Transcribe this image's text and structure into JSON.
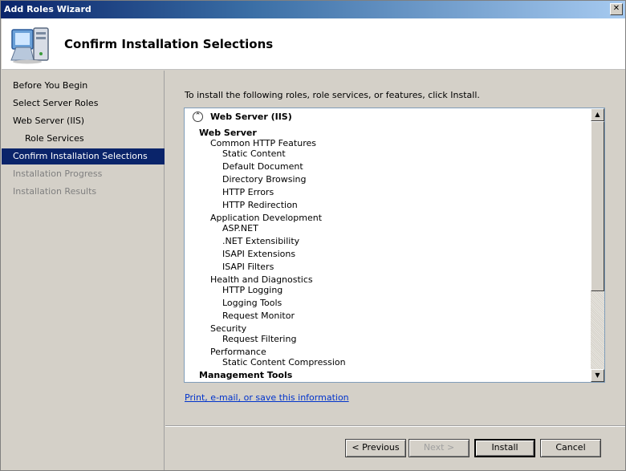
{
  "window": {
    "title": "Add Roles Wizard",
    "close_glyph": "✕"
  },
  "header": {
    "title": "Confirm Installation Selections",
    "icon": "computer-roles-icon"
  },
  "nav": {
    "items": [
      {
        "label": "Before You Begin",
        "state": "normal"
      },
      {
        "label": "Select Server Roles",
        "state": "normal"
      },
      {
        "label": "Web Server (IIS)",
        "state": "normal"
      },
      {
        "label": "Role Services",
        "state": "normal"
      },
      {
        "label": "Confirm Installation Selections",
        "state": "active"
      },
      {
        "label": "Installation Progress",
        "state": "disabled"
      },
      {
        "label": "Installation Results",
        "state": "disabled"
      }
    ]
  },
  "content": {
    "instruction": "To install the following roles, role services, or features, click Install.",
    "role_header": "Web Server (IIS)",
    "collapse_glyph": "⌃",
    "lines": [
      {
        "text": "Web Server",
        "level": 0
      },
      {
        "text": "Common HTTP Features",
        "level": 1
      },
      {
        "text": "Static Content",
        "level": 2
      },
      {
        "text": "Default Document",
        "level": 2
      },
      {
        "text": "Directory Browsing",
        "level": 2
      },
      {
        "text": "HTTP Errors",
        "level": 2
      },
      {
        "text": "HTTP Redirection",
        "level": 2
      },
      {
        "text": "Application Development",
        "level": 1
      },
      {
        "text": "ASP.NET",
        "level": 2
      },
      {
        "text": ".NET Extensibility",
        "level": 2
      },
      {
        "text": "ISAPI Extensions",
        "level": 2
      },
      {
        "text": "ISAPI Filters",
        "level": 2
      },
      {
        "text": "Health and Diagnostics",
        "level": 1
      },
      {
        "text": "HTTP Logging",
        "level": 2
      },
      {
        "text": "Logging Tools",
        "level": 2
      },
      {
        "text": "Request Monitor",
        "level": 2
      },
      {
        "text": "Security",
        "level": 1
      },
      {
        "text": "Request Filtering",
        "level": 2
      },
      {
        "text": "Performance",
        "level": 1
      },
      {
        "text": "Static Content Compression",
        "level": 2
      },
      {
        "text": "Management Tools",
        "level": 0
      }
    ],
    "link": "Print, e-mail, or save this information",
    "scroll_up_glyph": "▲",
    "scroll_down_glyph": "▼"
  },
  "footer": {
    "previous": "< Previous",
    "next": "Next >",
    "install": "Install",
    "cancel": "Cancel"
  },
  "colors": {
    "active_nav": "#0a246a",
    "link": "#0033cc",
    "dialog_bg": "#d4d0c8"
  }
}
